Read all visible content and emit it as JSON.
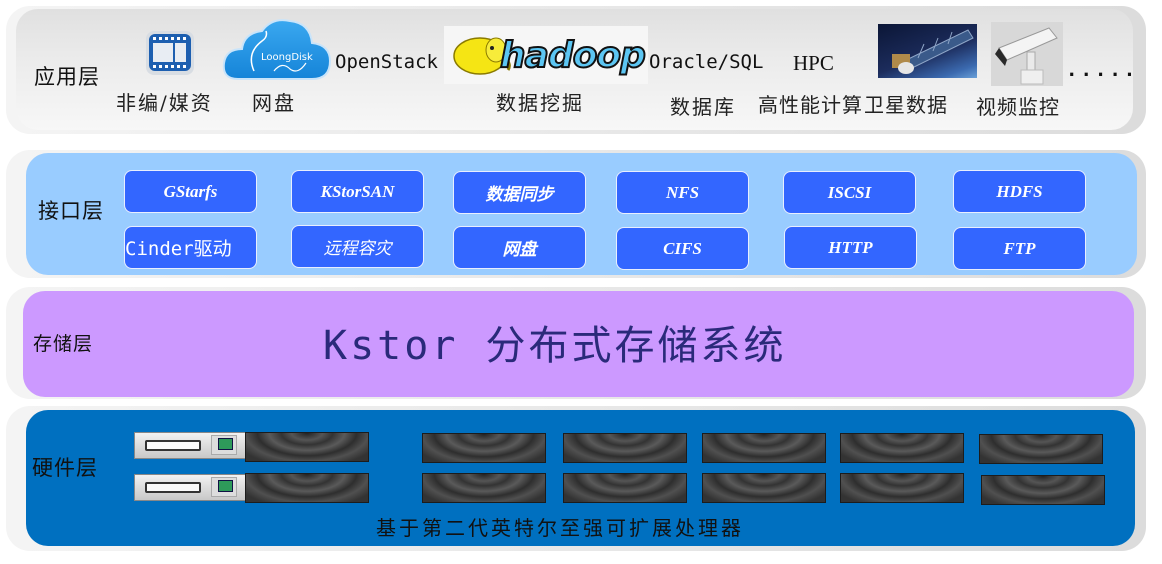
{
  "layers": {
    "application": {
      "label": "应用层",
      "items": [
        {
          "caption": "非编/媒资",
          "icon": "film-strip-icon"
        },
        {
          "caption": "网盘",
          "icon": "loongdisk-cloud-icon",
          "logo_text": "LoongDisk"
        },
        {
          "caption": "",
          "text": "OpenStack"
        },
        {
          "caption": "数据挖掘",
          "icon": "hadoop-elephant-icon",
          "logo_text": "hadoop"
        },
        {
          "caption": "数据库",
          "text": "Oracle/SQL"
        },
        {
          "caption": "高性能计算",
          "text": "HPC"
        },
        {
          "caption": "卫星数据",
          "icon": "satellite-image-icon"
        },
        {
          "caption": "视频监控",
          "icon": "cctv-camera-icon"
        },
        {
          "caption": "",
          "text": "....."
        }
      ]
    },
    "interface": {
      "label": "接口层",
      "buttons": [
        [
          "GStarfs",
          "KStorSAN",
          "数据同步",
          "NFS",
          "ISCSI",
          "HDFS"
        ],
        [
          "Cinder驱动",
          "远程容灾",
          "网盘",
          "CIFS",
          "HTTP",
          "FTP"
        ]
      ]
    },
    "storage": {
      "label": "存储层",
      "title": "Kstor 分布式存储系统"
    },
    "hardware": {
      "label": "硬件层",
      "caption": "基于第二代英特尔至强可扩展处理器",
      "servers_per_row": {
        "silver": 1,
        "dark": 6
      },
      "rows": 2
    }
  },
  "colors": {
    "application_bg": "#e8e8e8",
    "interface_bg": "#99ccff",
    "interface_button": "#3366ff",
    "storage_bg": "#cc99ff",
    "storage_title": "#2a2a7a",
    "hardware_bg": "#0070c0"
  }
}
